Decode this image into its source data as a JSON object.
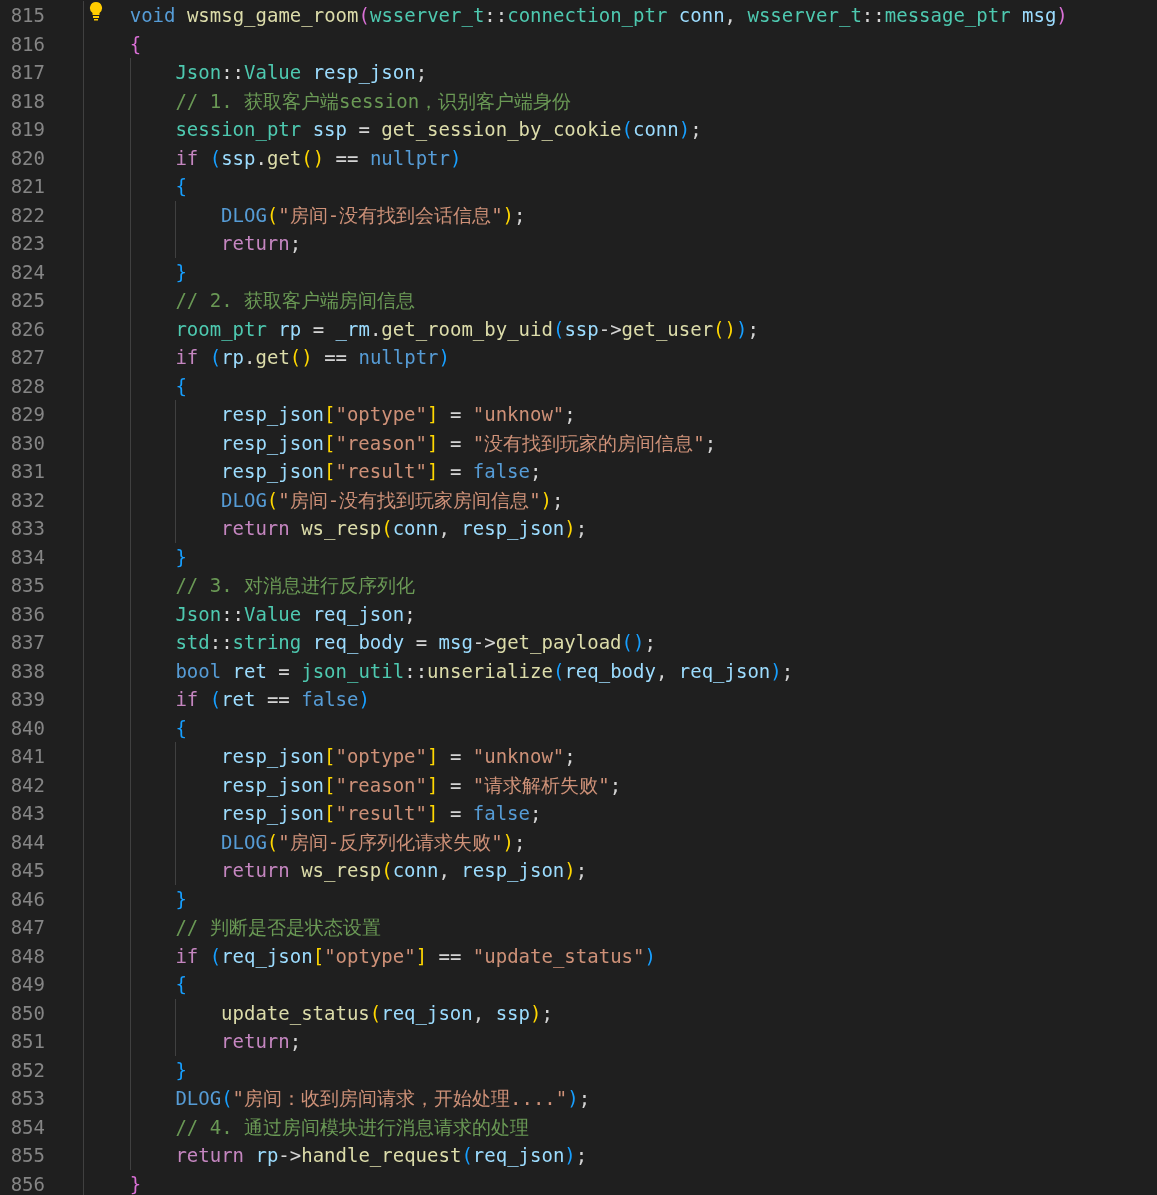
{
  "editor": {
    "lines": [
      {
        "number": "815",
        "tokens": [
          {
            "kind": "keyword",
            "text": "void "
          },
          {
            "kind": "function",
            "text": "wsmsg_game_room"
          },
          {
            "kind": "bracket2",
            "text": "("
          },
          {
            "kind": "type",
            "text": "wsserver_t"
          },
          {
            "kind": "plain",
            "text": "::"
          },
          {
            "kind": "type",
            "text": "connection_ptr "
          },
          {
            "kind": "variable",
            "text": "conn"
          },
          {
            "kind": "plain",
            "text": ", "
          },
          {
            "kind": "type",
            "text": "wsserver_t"
          },
          {
            "kind": "plain",
            "text": "::"
          },
          {
            "kind": "type",
            "text": "message_ptr "
          },
          {
            "kind": "variable",
            "text": "msg"
          },
          {
            "kind": "bracket2",
            "text": ")"
          }
        ]
      },
      {
        "number": "816",
        "tokens": [
          {
            "kind": "bracket2",
            "text": "{"
          }
        ],
        "children": [
          {
            "number": "817",
            "tokens": [
              {
                "kind": "type",
                "text": "Json"
              },
              {
                "kind": "plain",
                "text": "::"
              },
              {
                "kind": "type",
                "text": "Value "
              },
              {
                "kind": "variable",
                "text": "resp_json"
              },
              {
                "kind": "plain",
                "text": ";"
              }
            ]
          },
          {
            "number": "818",
            "tokens": [
              {
                "kind": "comment",
                "text": "// 1. 获取客户端session，识别客户端身份"
              }
            ]
          },
          {
            "number": "819",
            "tokens": [
              {
                "kind": "type",
                "text": "session_ptr "
              },
              {
                "kind": "variable",
                "text": "ssp"
              },
              {
                "kind": "plain",
                "text": " = "
              },
              {
                "kind": "function",
                "text": "get_session_by_cookie"
              },
              {
                "kind": "bracket3",
                "text": "("
              },
              {
                "kind": "variable",
                "text": "conn"
              },
              {
                "kind": "bracket3",
                "text": ")"
              },
              {
                "kind": "plain",
                "text": ";"
              }
            ]
          },
          {
            "number": "820",
            "tokens": [
              {
                "kind": "control",
                "text": "if "
              },
              {
                "kind": "bracket3",
                "text": "("
              },
              {
                "kind": "variable",
                "text": "ssp"
              },
              {
                "kind": "plain",
                "text": "."
              },
              {
                "kind": "function",
                "text": "get"
              },
              {
                "kind": "bracket1",
                "text": "()"
              },
              {
                "kind": "plain",
                "text": " == "
              },
              {
                "kind": "keyword",
                "text": "nullptr"
              },
              {
                "kind": "bracket3",
                "text": ")"
              }
            ]
          },
          {
            "number": "821",
            "tokens": [
              {
                "kind": "bracket3",
                "text": "{"
              }
            ],
            "children": [
              {
                "number": "822",
                "tokens": [
                  {
                    "kind": "keyword",
                    "text": "DLOG"
                  },
                  {
                    "kind": "bracket1",
                    "text": "("
                  },
                  {
                    "kind": "string",
                    "text": "\"房间-没有找到会话信息\""
                  },
                  {
                    "kind": "bracket1",
                    "text": ")"
                  },
                  {
                    "kind": "plain",
                    "text": ";"
                  }
                ]
              },
              {
                "number": "823",
                "tokens": [
                  {
                    "kind": "control",
                    "text": "return"
                  },
                  {
                    "kind": "plain",
                    "text": ";"
                  }
                ]
              }
            ]
          },
          {
            "number": "824",
            "tokens": [
              {
                "kind": "bracket3",
                "text": "}"
              }
            ]
          },
          {
            "number": "825",
            "tokens": [
              {
                "kind": "comment",
                "text": "// 2. 获取客户端房间信息"
              }
            ]
          },
          {
            "number": "826",
            "tokens": [
              {
                "kind": "type",
                "text": "room_ptr "
              },
              {
                "kind": "variable",
                "text": "rp"
              },
              {
                "kind": "plain",
                "text": " = "
              },
              {
                "kind": "variable",
                "text": "_rm"
              },
              {
                "kind": "plain",
                "text": "."
              },
              {
                "kind": "function",
                "text": "get_room_by_uid"
              },
              {
                "kind": "bracket3",
                "text": "("
              },
              {
                "kind": "variable",
                "text": "ssp"
              },
              {
                "kind": "plain",
                "text": "->"
              },
              {
                "kind": "function",
                "text": "get_user"
              },
              {
                "kind": "bracket1",
                "text": "()"
              },
              {
                "kind": "bracket3",
                "text": ")"
              },
              {
                "kind": "plain",
                "text": ";"
              }
            ]
          },
          {
            "number": "827",
            "tokens": [
              {
                "kind": "control",
                "text": "if "
              },
              {
                "kind": "bracket3",
                "text": "("
              },
              {
                "kind": "variable",
                "text": "rp"
              },
              {
                "kind": "plain",
                "text": "."
              },
              {
                "kind": "function",
                "text": "get"
              },
              {
                "kind": "bracket1",
                "text": "()"
              },
              {
                "kind": "plain",
                "text": " == "
              },
              {
                "kind": "keyword",
                "text": "nullptr"
              },
              {
                "kind": "bracket3",
                "text": ")"
              }
            ]
          },
          {
            "number": "828",
            "tokens": [
              {
                "kind": "bracket3",
                "text": "{"
              }
            ],
            "children": [
              {
                "number": "829",
                "tokens": [
                  {
                    "kind": "variable",
                    "text": "resp_json"
                  },
                  {
                    "kind": "bracket1",
                    "text": "["
                  },
                  {
                    "kind": "string",
                    "text": "\"optype\""
                  },
                  {
                    "kind": "bracket1",
                    "text": "]"
                  },
                  {
                    "kind": "plain",
                    "text": " = "
                  },
                  {
                    "kind": "string",
                    "text": "\"unknow\""
                  },
                  {
                    "kind": "plain",
                    "text": ";"
                  }
                ]
              },
              {
                "number": "830",
                "tokens": [
                  {
                    "kind": "variable",
                    "text": "resp_json"
                  },
                  {
                    "kind": "bracket1",
                    "text": "["
                  },
                  {
                    "kind": "string",
                    "text": "\"reason\""
                  },
                  {
                    "kind": "bracket1",
                    "text": "]"
                  },
                  {
                    "kind": "plain",
                    "text": " = "
                  },
                  {
                    "kind": "string",
                    "text": "\"没有找到玩家的房间信息\""
                  },
                  {
                    "kind": "plain",
                    "text": ";"
                  }
                ]
              },
              {
                "number": "831",
                "tokens": [
                  {
                    "kind": "variable",
                    "text": "resp_json"
                  },
                  {
                    "kind": "bracket1",
                    "text": "["
                  },
                  {
                    "kind": "string",
                    "text": "\"result\""
                  },
                  {
                    "kind": "bracket1",
                    "text": "]"
                  },
                  {
                    "kind": "plain",
                    "text": " = "
                  },
                  {
                    "kind": "keyword",
                    "text": "false"
                  },
                  {
                    "kind": "plain",
                    "text": ";"
                  }
                ]
              },
              {
                "number": "832",
                "tokens": [
                  {
                    "kind": "keyword",
                    "text": "DLOG"
                  },
                  {
                    "kind": "bracket1",
                    "text": "("
                  },
                  {
                    "kind": "string",
                    "text": "\"房间-没有找到玩家房间信息\""
                  },
                  {
                    "kind": "bracket1",
                    "text": ")"
                  },
                  {
                    "kind": "plain",
                    "text": ";"
                  }
                ]
              },
              {
                "number": "833",
                "tokens": [
                  {
                    "kind": "control",
                    "text": "return "
                  },
                  {
                    "kind": "function",
                    "text": "ws_resp"
                  },
                  {
                    "kind": "bracket1",
                    "text": "("
                  },
                  {
                    "kind": "variable",
                    "text": "conn"
                  },
                  {
                    "kind": "plain",
                    "text": ", "
                  },
                  {
                    "kind": "variable",
                    "text": "resp_json"
                  },
                  {
                    "kind": "bracket1",
                    "text": ")"
                  },
                  {
                    "kind": "plain",
                    "text": ";"
                  }
                ]
              }
            ]
          },
          {
            "number": "834",
            "tokens": [
              {
                "kind": "bracket3",
                "text": "}"
              }
            ]
          },
          {
            "number": "835",
            "tokens": [
              {
                "kind": "comment",
                "text": "// 3. 对消息进行反序列化"
              }
            ]
          },
          {
            "number": "836",
            "tokens": [
              {
                "kind": "type",
                "text": "Json"
              },
              {
                "kind": "plain",
                "text": "::"
              },
              {
                "kind": "type",
                "text": "Value "
              },
              {
                "kind": "variable",
                "text": "req_json"
              },
              {
                "kind": "plain",
                "text": ";"
              }
            ]
          },
          {
            "number": "837",
            "tokens": [
              {
                "kind": "type",
                "text": "std"
              },
              {
                "kind": "plain",
                "text": "::"
              },
              {
                "kind": "type",
                "text": "string "
              },
              {
                "kind": "variable",
                "text": "req_body"
              },
              {
                "kind": "plain",
                "text": " = "
              },
              {
                "kind": "variable",
                "text": "msg"
              },
              {
                "kind": "plain",
                "text": "->"
              },
              {
                "kind": "function",
                "text": "get_payload"
              },
              {
                "kind": "bracket3",
                "text": "()"
              },
              {
                "kind": "plain",
                "text": ";"
              }
            ]
          },
          {
            "number": "838",
            "tokens": [
              {
                "kind": "keyword",
                "text": "bool "
              },
              {
                "kind": "variable",
                "text": "ret"
              },
              {
                "kind": "plain",
                "text": " = "
              },
              {
                "kind": "type",
                "text": "json_util"
              },
              {
                "kind": "plain",
                "text": "::"
              },
              {
                "kind": "function",
                "text": "unserialize"
              },
              {
                "kind": "bracket3",
                "text": "("
              },
              {
                "kind": "variable",
                "text": "req_body"
              },
              {
                "kind": "plain",
                "text": ", "
              },
              {
                "kind": "variable",
                "text": "req_json"
              },
              {
                "kind": "bracket3",
                "text": ")"
              },
              {
                "kind": "plain",
                "text": ";"
              }
            ]
          },
          {
            "number": "839",
            "tokens": [
              {
                "kind": "control",
                "text": "if "
              },
              {
                "kind": "bracket3",
                "text": "("
              },
              {
                "kind": "variable",
                "text": "ret"
              },
              {
                "kind": "plain",
                "text": " == "
              },
              {
                "kind": "keyword",
                "text": "false"
              },
              {
                "kind": "bracket3",
                "text": ")"
              }
            ]
          },
          {
            "number": "840",
            "tokens": [
              {
                "kind": "bracket3",
                "text": "{"
              }
            ],
            "children": [
              {
                "number": "841",
                "tokens": [
                  {
                    "kind": "variable",
                    "text": "resp_json"
                  },
                  {
                    "kind": "bracket1",
                    "text": "["
                  },
                  {
                    "kind": "string",
                    "text": "\"optype\""
                  },
                  {
                    "kind": "bracket1",
                    "text": "]"
                  },
                  {
                    "kind": "plain",
                    "text": " = "
                  },
                  {
                    "kind": "string",
                    "text": "\"unknow\""
                  },
                  {
                    "kind": "plain",
                    "text": ";"
                  }
                ]
              },
              {
                "number": "842",
                "tokens": [
                  {
                    "kind": "variable",
                    "text": "resp_json"
                  },
                  {
                    "kind": "bracket1",
                    "text": "["
                  },
                  {
                    "kind": "string",
                    "text": "\"reason\""
                  },
                  {
                    "kind": "bracket1",
                    "text": "]"
                  },
                  {
                    "kind": "plain",
                    "text": " = "
                  },
                  {
                    "kind": "string",
                    "text": "\"请求解析失败\""
                  },
                  {
                    "kind": "plain",
                    "text": ";"
                  }
                ]
              },
              {
                "number": "843",
                "tokens": [
                  {
                    "kind": "variable",
                    "text": "resp_json"
                  },
                  {
                    "kind": "bracket1",
                    "text": "["
                  },
                  {
                    "kind": "string",
                    "text": "\"result\""
                  },
                  {
                    "kind": "bracket1",
                    "text": "]"
                  },
                  {
                    "kind": "plain",
                    "text": " = "
                  },
                  {
                    "kind": "keyword",
                    "text": "false"
                  },
                  {
                    "kind": "plain",
                    "text": ";"
                  }
                ]
              },
              {
                "number": "844",
                "tokens": [
                  {
                    "kind": "keyword",
                    "text": "DLOG"
                  },
                  {
                    "kind": "bracket1",
                    "text": "("
                  },
                  {
                    "kind": "string",
                    "text": "\"房间-反序列化请求失败\""
                  },
                  {
                    "kind": "bracket1",
                    "text": ")"
                  },
                  {
                    "kind": "plain",
                    "text": ";"
                  }
                ]
              },
              {
                "number": "845",
                "tokens": [
                  {
                    "kind": "control",
                    "text": "return "
                  },
                  {
                    "kind": "function",
                    "text": "ws_resp"
                  },
                  {
                    "kind": "bracket1",
                    "text": "("
                  },
                  {
                    "kind": "variable",
                    "text": "conn"
                  },
                  {
                    "kind": "plain",
                    "text": ", "
                  },
                  {
                    "kind": "variable",
                    "text": "resp_json"
                  },
                  {
                    "kind": "bracket1",
                    "text": ")"
                  },
                  {
                    "kind": "plain",
                    "text": ";"
                  }
                ]
              }
            ]
          },
          {
            "number": "846",
            "tokens": [
              {
                "kind": "bracket3",
                "text": "}"
              }
            ]
          },
          {
            "number": "847",
            "tokens": [
              {
                "kind": "comment",
                "text": "// 判断是否是状态设置"
              }
            ]
          },
          {
            "number": "848",
            "tokens": [
              {
                "kind": "control",
                "text": "if "
              },
              {
                "kind": "bracket3",
                "text": "("
              },
              {
                "kind": "variable",
                "text": "req_json"
              },
              {
                "kind": "bracket1",
                "text": "["
              },
              {
                "kind": "string",
                "text": "\"optype\""
              },
              {
                "kind": "bracket1",
                "text": "]"
              },
              {
                "kind": "plain",
                "text": " == "
              },
              {
                "kind": "string",
                "text": "\"update_status\""
              },
              {
                "kind": "bracket3",
                "text": ")"
              }
            ]
          },
          {
            "number": "849",
            "tokens": [
              {
                "kind": "bracket3",
                "text": "{"
              }
            ],
            "children": [
              {
                "number": "850",
                "tokens": [
                  {
                    "kind": "function",
                    "text": "update_status"
                  },
                  {
                    "kind": "bracket1",
                    "text": "("
                  },
                  {
                    "kind": "variable",
                    "text": "req_json"
                  },
                  {
                    "kind": "plain",
                    "text": ", "
                  },
                  {
                    "kind": "variable",
                    "text": "ssp"
                  },
                  {
                    "kind": "bracket1",
                    "text": ")"
                  },
                  {
                    "kind": "plain",
                    "text": ";"
                  }
                ]
              },
              {
                "number": "851",
                "tokens": [
                  {
                    "kind": "control",
                    "text": "return"
                  },
                  {
                    "kind": "plain",
                    "text": ";"
                  }
                ]
              }
            ]
          },
          {
            "number": "852",
            "tokens": [
              {
                "kind": "bracket3",
                "text": "}"
              }
            ]
          },
          {
            "number": "853",
            "tokens": [
              {
                "kind": "keyword",
                "text": "DLOG"
              },
              {
                "kind": "bracket3",
                "text": "("
              },
              {
                "kind": "string",
                "text": "\"房间：收到房间请求，开始处理....\""
              },
              {
                "kind": "bracket3",
                "text": ")"
              },
              {
                "kind": "plain",
                "text": ";"
              }
            ]
          },
          {
            "number": "854",
            "tokens": [
              {
                "kind": "comment",
                "text": "// 4. 通过房间模块进行消息请求的处理"
              }
            ]
          },
          {
            "number": "855",
            "tokens": [
              {
                "kind": "control",
                "text": "return "
              },
              {
                "kind": "variable",
                "text": "rp"
              },
              {
                "kind": "plain",
                "text": "->"
              },
              {
                "kind": "function",
                "text": "handle_request"
              },
              {
                "kind": "bracket3",
                "text": "("
              },
              {
                "kind": "variable",
                "text": "req_json"
              },
              {
                "kind": "bracket3",
                "text": ")"
              },
              {
                "kind": "plain",
                "text": ";"
              }
            ]
          }
        ]
      },
      {
        "number": "856",
        "tokens": [
          {
            "kind": "bracket2",
            "text": "}"
          }
        ]
      }
    ]
  }
}
